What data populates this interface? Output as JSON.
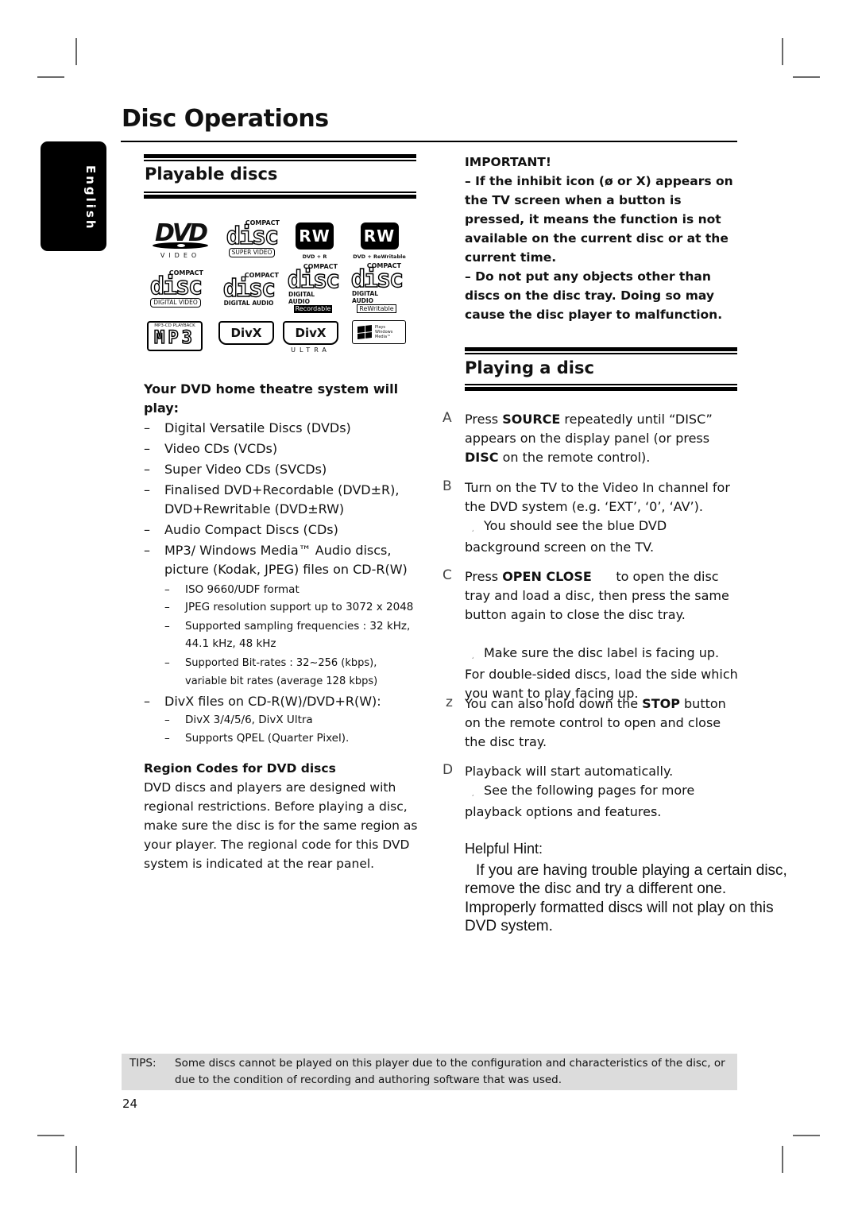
{
  "language_tab": "English",
  "page_title": "Disc Operations",
  "playable_discs": {
    "heading": "Playable discs",
    "logos": [
      {
        "name": "dvd-video",
        "mark": "DVD",
        "caption": "VIDEO"
      },
      {
        "name": "super-video-cd",
        "top": "COMPACT",
        "mark": "disc",
        "caption": "SUPER VIDEO"
      },
      {
        "name": "dvd-plus-r",
        "mark": "RW",
        "caption": "DVD + R"
      },
      {
        "name": "dvd-plus-rewritable",
        "mark": "RW",
        "caption": "DVD + ReWritable"
      },
      {
        "name": "digital-video-cd",
        "top": "COMPACT",
        "mark": "disc",
        "caption": "DIGITAL VIDEO"
      },
      {
        "name": "digital-audio-cd",
        "top": "COMPACT",
        "mark": "disc",
        "caption": "DIGITAL AUDIO"
      },
      {
        "name": "cd-recordable",
        "top": "COMPACT",
        "mark": "disc",
        "caption": "DIGITAL AUDIO",
        "caption2": "Recordable"
      },
      {
        "name": "cd-rewritable",
        "top": "COMPACT",
        "mark": "disc",
        "caption": "DIGITAL AUDIO",
        "caption2": "ReWritable"
      },
      {
        "name": "mp3-cd",
        "top": "MP3-CD PLAYBACK",
        "mark": "MP3"
      },
      {
        "name": "divx",
        "mark": "DivX"
      },
      {
        "name": "divx-ultra",
        "mark": "DivX",
        "caption": "ULTRA"
      },
      {
        "name": "windows-media",
        "line1": "Plays",
        "line2": "Windows",
        "line3": "Media™"
      }
    ],
    "plays_heading": "Your DVD home theatre system will play:",
    "plays_list": [
      "Digital Versatile Discs (DVDs)",
      "Video CDs (VCDs)",
      "Super Video CDs (SVCDs)",
      "Finalised DVD+Recordable (DVD±R), DVD+Rewritable (DVD±RW)",
      "Audio Compact Discs (CDs)",
      "MP3/ Windows Media™ Audio discs, picture (Kodak, JPEG) files on CD-R(W)"
    ],
    "mp3_sublist": [
      "ISO 9660/UDF format",
      "JPEG resolution support up to 3072 x 2048",
      "Supported sampling frequencies : 32 kHz, 44.1 kHz, 48 kHz",
      "Supported Bit-rates : 32~256 (kbps), variable bit rates (average 128 kbps)"
    ],
    "divx_item": "DivX files on CD-R(W)/DVD+R(W):",
    "divx_sublist": [
      "DivX 3/4/5/6, DivX Ultra",
      "Supports QPEL (Quarter Pixel)."
    ],
    "dash": "–",
    "region_heading": "Region Codes for DVD discs",
    "region_text": "DVD discs and players are designed with regional restrictions. Before playing a disc, make sure the disc is for the same region as your player.  The regional code for this DVD system is indicated at the rear panel."
  },
  "important": {
    "heading": "IMPORTANT!",
    "items": [
      "– If the inhibit icon (ø or X) appears on the TV screen when a button is pressed, it means the function is not available on the current disc or at the current time.",
      "– Do not put any objects other than discs on the disc tray.  Doing so may cause the disc player to malfunction."
    ]
  },
  "playing_disc": {
    "heading": "Playing a disc",
    "steps": [
      {
        "letter": "A",
        "pre": "Press ",
        "b1": "SOURCE",
        "mid": " repeatedly until “DISC” appears on the display panel (or press ",
        "b2": "DISC",
        "post": " on the remote control)."
      },
      {
        "letter": "B",
        "text": "Turn on the TV to the Video In channel for the DVD system (e.g. ‘EXT’, ‘0’, ‘AV’).",
        "note_mark": "¸",
        "note": "You should see the blue DVD background screen on the TV."
      },
      {
        "letter": "C",
        "pre": "Press ",
        "b1": "OPEN CLOSE",
        "post": "      to open the disc tray and load a disc, then press the same button again to close the disc tray.",
        "note_mark": "¸",
        "note": "Make sure the disc label is facing up. For double-sided discs, load the side which you want to play facing up."
      },
      {
        "letter": "z",
        "pre": "You can also hold down the ",
        "b1": "STOP",
        "post": " button on the remote control to open and close the disc tray."
      },
      {
        "letter": "D",
        "text": "Playback will start automatically.",
        "note_mark": "¸",
        "note": "See the following pages for more playback options and features."
      }
    ],
    "hint_heading": "Helpful Hint:",
    "hint_text": "If you are having trouble playing a certain disc, remove the disc and try a different one. Improperly formatted discs will not play on this DVD system."
  },
  "tips": {
    "label": "TIPS:",
    "text": "Some discs cannot be played on this player due to the configuration and characteristics of the disc, or due to the condition of recording and authoring software that was used."
  },
  "page_number": "24"
}
